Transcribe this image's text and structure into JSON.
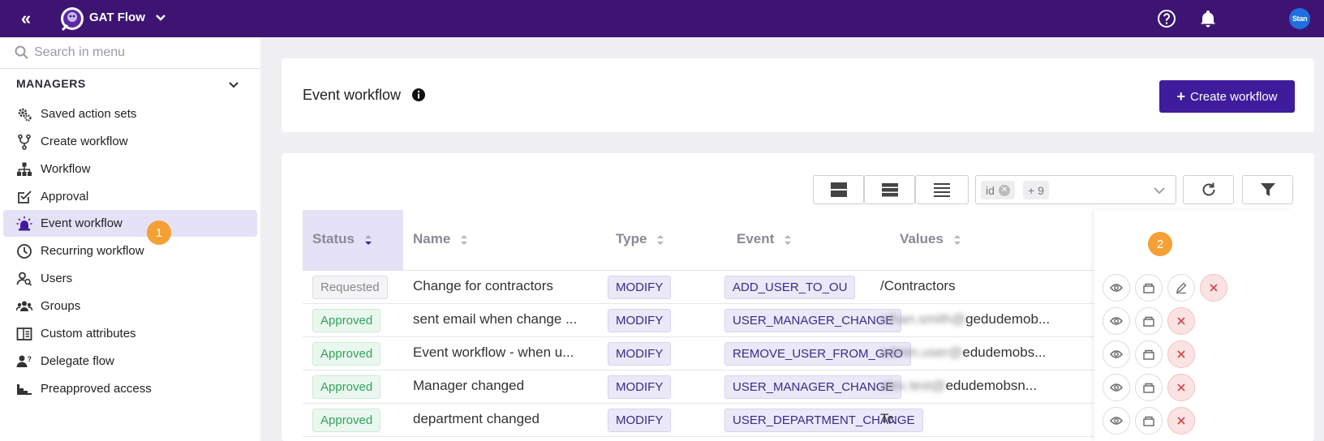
{
  "topbar": {
    "app_name": "GAT Flow",
    "avatar_text": "Stan",
    "colors": {
      "bar": "#3e1473",
      "accent": "#3e1c9c"
    }
  },
  "sidebar": {
    "search_placeholder": "Search in menu",
    "section_title": "MANAGERS",
    "items": [
      {
        "label": "Saved action sets",
        "icon": "gears-icon"
      },
      {
        "label": "Create workflow",
        "icon": "branch-icon"
      },
      {
        "label": "Workflow",
        "icon": "hierarchy-icon"
      },
      {
        "label": "Approval",
        "icon": "checklist-icon"
      },
      {
        "label": "Event workflow",
        "icon": "siren-icon",
        "active": true
      },
      {
        "label": "Recurring workflow",
        "icon": "clock-icon"
      },
      {
        "label": "Users",
        "icon": "user-search-icon"
      },
      {
        "label": "Groups",
        "icon": "group-icon"
      },
      {
        "label": "Custom attributes",
        "icon": "book-icon"
      },
      {
        "label": "Delegate flow",
        "icon": "user-question-icon"
      },
      {
        "label": "Preapproved access",
        "icon": "stairs-icon"
      }
    ],
    "callout_1": "1"
  },
  "header": {
    "title": "Event workflow",
    "create_button": "Create workflow"
  },
  "toolbar": {
    "column_chip": "id",
    "more_chip": "+ 9"
  },
  "table": {
    "columns": [
      "Status",
      "Name",
      "Type",
      "Event",
      "Values"
    ],
    "callout_2": "2",
    "rows": [
      {
        "status": "Requested",
        "name": "Change for contractors",
        "type": "MODIFY",
        "event": "ADD_USER_TO_OU",
        "value": "/Contractors",
        "actions": [
          "view",
          "copy",
          "edit",
          "delete"
        ]
      },
      {
        "status": "Approved",
        "name": "sent email when change ...",
        "type": "MODIFY",
        "event": "USER_MANAGER_CHANGE",
        "value_hidden": "ethan.smith@",
        "value": "gedudemob...",
        "actions": [
          "view",
          "copy",
          "delete"
        ]
      },
      {
        "status": "Approved",
        "name": "Event workflow - when u...",
        "type": "MODIFY",
        "event": "REMOVE_USER_FROM_GRO",
        "value_hidden": "admin.user@",
        "value": "edudemobs...",
        "actions": [
          "view",
          "copy",
          "delete"
        ]
      },
      {
        "status": "Approved",
        "name": "Manager changed",
        "type": "MODIFY",
        "event": "USER_MANAGER_CHANGE",
        "value_hidden": "alex.test@",
        "value": "edudemobsn...",
        "actions": [
          "view",
          "copy",
          "delete"
        ]
      },
      {
        "status": "Approved",
        "name": "department changed",
        "type": "MODIFY",
        "event": "USER_DEPARTMENT_CHANGE",
        "value": "Tc",
        "actions": [
          "view",
          "copy",
          "delete"
        ]
      }
    ]
  }
}
